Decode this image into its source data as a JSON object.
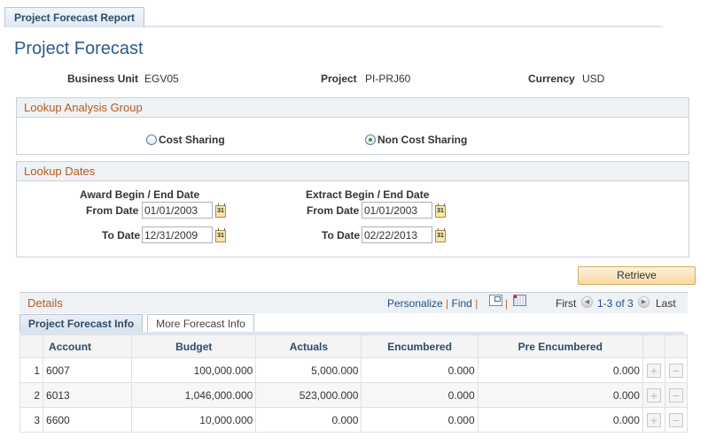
{
  "page_tab": "Project Forecast Report",
  "page_title": "Project Forecast",
  "header_fields": {
    "business_unit": {
      "label": "Business Unit",
      "value": "EGV05"
    },
    "project": {
      "label": "Project",
      "value": "PI-PRJ60"
    },
    "currency": {
      "label": "Currency",
      "value": "USD"
    }
  },
  "analysis_group": {
    "title": "Lookup Analysis Group",
    "options": [
      {
        "label": "Cost Sharing",
        "selected": false
      },
      {
        "label": "Non Cost Sharing",
        "selected": true
      }
    ]
  },
  "lookup_dates": {
    "title": "Lookup Dates",
    "award": {
      "heading": "Award Begin / End Date",
      "from_label": "From Date",
      "from_value": "01/01/2003",
      "to_label": "To Date",
      "to_value": "12/31/2009"
    },
    "extract": {
      "heading": "Extract Begin / End Date",
      "from_label": "From Date",
      "from_value": "01/01/2003",
      "to_label": "To Date",
      "to_value": "02/22/2013"
    },
    "calendar_icon_text": "31"
  },
  "retrieve_label": "Retrieve",
  "details": {
    "title": "Details",
    "toolbar": {
      "personalize": "Personalize",
      "find": "Find",
      "separator": "|",
      "first": "First",
      "range": "1-3 of 3",
      "last": "Last"
    },
    "tabs": [
      {
        "label": "Project Forecast Info",
        "active": true
      },
      {
        "label": "More Forecast Info",
        "active": false
      }
    ],
    "columns": [
      "",
      "Account",
      "Budget",
      "Actuals",
      "Encumbered",
      "Pre Encumbered",
      "",
      ""
    ],
    "rows": [
      {
        "num": "1",
        "account": "6007",
        "budget": "100,000.000",
        "actuals": "5,000.000",
        "encumbered": "0.000",
        "pre_encumbered": "0.000"
      },
      {
        "num": "2",
        "account": "6013",
        "budget": "1,046,000.000",
        "actuals": "523,000.000",
        "encumbered": "0.000",
        "pre_encumbered": "0.000"
      },
      {
        "num": "3",
        "account": "6600",
        "budget": "10,000.000",
        "actuals": "0.000",
        "encumbered": "0.000",
        "pre_encumbered": "0.000"
      }
    ],
    "add_row_symbol": "+",
    "delete_row_symbol": "−"
  }
}
